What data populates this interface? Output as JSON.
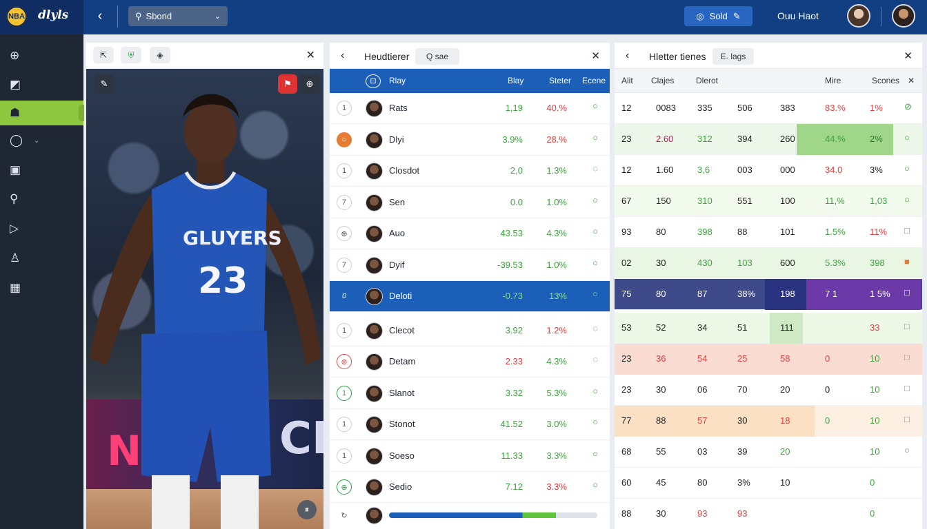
{
  "topbar": {
    "logo_badge": "NBA",
    "logo_text": "dlyls",
    "search_label": "Sbond",
    "pill_label": "Sold",
    "user_name": "Ouu Haot"
  },
  "sidebar": {
    "items": [
      {
        "icon": "plus-circle-icon",
        "glyph": "⊕"
      },
      {
        "icon": "edit-icon",
        "glyph": "◩"
      },
      {
        "icon": "team-icon",
        "glyph": "☗",
        "active": true
      },
      {
        "icon": "refresh-icon",
        "glyph": "◯",
        "caret": "⌄"
      },
      {
        "icon": "calendar-icon",
        "glyph": "▣"
      },
      {
        "icon": "search-icon",
        "glyph": "⚲"
      },
      {
        "icon": "play-icon",
        "glyph": "▷"
      },
      {
        "icon": "user-icon",
        "glyph": "♙"
      },
      {
        "icon": "grid-icon",
        "glyph": "▦"
      }
    ]
  },
  "image_panel": {
    "jersey_team": "GLUYERS",
    "jersey_number": "23",
    "board_right": "CI",
    "board_left": "N",
    "close": "✕"
  },
  "list_panel": {
    "title": "Heudtierer",
    "tag": "Q sae",
    "columns": {
      "player": "Rlay",
      "c2": "Blay",
      "c3": "Steter",
      "c4": "Ecene"
    },
    "rows": [
      {
        "num": "1",
        "name": "Rats",
        "v1": "1,19",
        "v2": "40.%",
        "v2color": "red",
        "st": "○"
      },
      {
        "num": "○",
        "name": "Dlyi",
        "v1": "3.9%",
        "v2": "28.%",
        "v2color": "red",
        "st": "○",
        "numstyle": "orange"
      },
      {
        "num": "1",
        "name": "Closdot",
        "v1": "2,0",
        "v2": "1.3%",
        "v2color": "green",
        "st": "◌"
      },
      {
        "num": "7",
        "name": "Sen",
        "v1": "0.0",
        "v2": "1.0%",
        "v2color": "green",
        "st": "○"
      },
      {
        "num": "⊕",
        "name": "Auo",
        "v1": "43.53",
        "v2": "4.3%",
        "v2color": "green",
        "st": "○"
      },
      {
        "num": "7",
        "name": "Dyif",
        "v1": "-39.53",
        "v2": "1.0%",
        "v2color": "green",
        "st": "○"
      },
      {
        "num": "0",
        "name": "Deloti",
        "v1": "-0.73",
        "v2": "13%",
        "v2color": "green",
        "st": "○",
        "selected": true
      },
      {
        "num": "1",
        "name": "Clecot",
        "v1": "3.92",
        "v2": "1.2%",
        "v2color": "red",
        "st": "◌"
      },
      {
        "num": "⊕",
        "name": "Detam",
        "v1": "2.33",
        "v2": "4.3%",
        "v2color": "green",
        "st": "◌",
        "v1color": "red",
        "numstyle": "red"
      },
      {
        "num": "1",
        "name": "Slanot",
        "v1": "3.32",
        "v2": "5.3%",
        "v2color": "green",
        "st": "○",
        "numstyle": "green"
      },
      {
        "num": "1",
        "name": "Stonot",
        "v1": "41.52",
        "v2": "3.0%",
        "v2color": "green",
        "st": "○"
      },
      {
        "num": "1",
        "name": "Soeso",
        "v1": "11.33",
        "v2": "3.3%",
        "v2color": "green",
        "st": "○"
      },
      {
        "num": "⊕",
        "name": "Sedio",
        "v1": "7.12",
        "v2": "3.3%",
        "v2color": "red",
        "st": "○",
        "numstyle": "green"
      }
    ],
    "last_row_num": "↻",
    "last_row_progress": 0.8
  },
  "stats_panel": {
    "title": "Hletter tienes",
    "tag": "E. lags",
    "columns": [
      "Alit",
      "Clajes",
      "Dlerot",
      "Mire",
      "Scones"
    ],
    "rows": [
      [
        "12",
        "0083",
        "335",
        "506",
        "383",
        "83.%",
        "1%",
        "⊘"
      ],
      [
        "23",
        "2.60",
        "312",
        "394",
        "260",
        "44.%",
        "2%",
        "○"
      ],
      [
        "12",
        "1.60",
        "3,6",
        "003",
        "000",
        "34.0",
        "3%",
        "○"
      ],
      [
        "67",
        "150",
        "310",
        "551",
        "100",
        "11,%",
        "1,03",
        "○"
      ],
      [
        "93",
        "80",
        "398",
        "88",
        "101",
        "1.5%",
        "11%",
        "□"
      ],
      [
        "02",
        "30",
        "430",
        "103",
        "600",
        "5.3%",
        "398",
        "■"
      ],
      [
        "75",
        "80",
        "87",
        "38%",
        "198",
        "7 1",
        "1 5%",
        "□"
      ],
      [
        "53",
        "52",
        "34",
        "51",
        "111",
        "",
        "33",
        "□"
      ],
      [
        "23",
        "36",
        "54",
        "25",
        "58",
        "0",
        "10",
        "□"
      ],
      [
        "23",
        "30",
        "06",
        "70",
        "20",
        "0",
        "10",
        "□"
      ],
      [
        "77",
        "88",
        "57",
        "30",
        "18",
        "0",
        "10",
        "□"
      ],
      [
        "68",
        "55",
        "03",
        "39",
        "20",
        "",
        "10",
        "○"
      ],
      [
        "60",
        "45",
        "80",
        "3%",
        "10",
        "",
        "0",
        ""
      ],
      [
        "88",
        "30",
        "93",
        "93",
        "",
        "",
        "0",
        ""
      ]
    ]
  }
}
